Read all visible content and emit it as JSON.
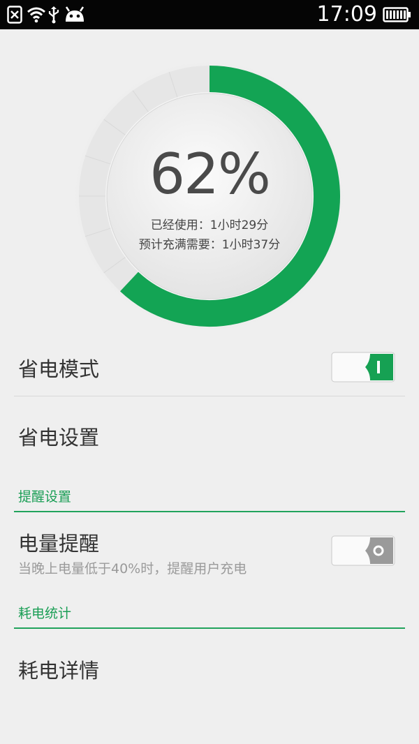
{
  "status_bar": {
    "time": "17:09",
    "icons": [
      "notification-close-icon",
      "wifi-icon",
      "usb-icon",
      "android-icon",
      "battery-icon"
    ]
  },
  "battery": {
    "percent_label": "62%",
    "level": 0.62,
    "used_label": "已经使用：1小时29分",
    "full_label": "预计充满需要：1小时37分",
    "accent_color": "#13a454"
  },
  "settings": {
    "power_saving_mode": {
      "label": "省电模式",
      "enabled": true
    },
    "power_saving_settings": {
      "label": "省电设置"
    },
    "reminder_section": {
      "header": "提醒设置"
    },
    "battery_reminder": {
      "label": "电量提醒",
      "description": "当晚上电量低于40%时，提醒用户充电",
      "enabled": false
    },
    "usage_section": {
      "header": "耗电统计"
    },
    "usage_details": {
      "label": "耗电详情"
    }
  }
}
